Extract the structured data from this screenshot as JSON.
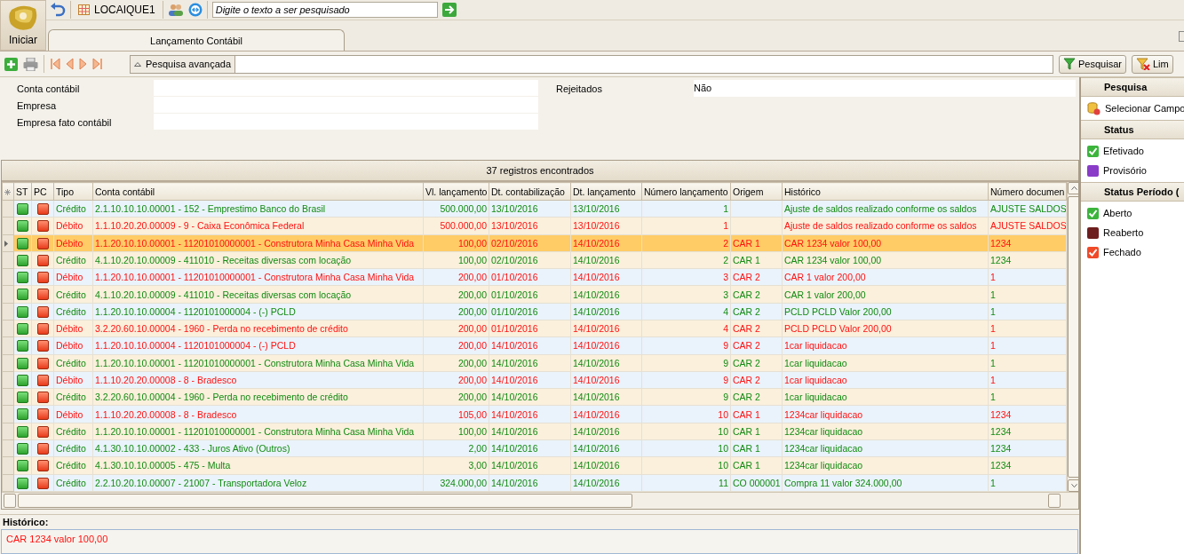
{
  "header": {
    "start_label": "Iniciar",
    "company": "LOCAIQUE1",
    "search_placeholder": "Digite o texto a ser pesquisado"
  },
  "tabs": [
    {
      "label": "Lançamento Contábil",
      "selected": true
    }
  ],
  "toolbar": {
    "advanced_search": "Pesquisa avançada",
    "search_button": "Pesquisar",
    "clear_button": "Lim"
  },
  "filters": {
    "left": [
      {
        "label": "Conta contábil"
      },
      {
        "label": "Empresa"
      },
      {
        "label": "Empresa fato contábil"
      }
    ],
    "right": [
      {
        "label": "Rejeitados",
        "value": "Não"
      }
    ]
  },
  "grid": {
    "title": "37 registros encontrados",
    "columns": [
      "ST",
      "PC",
      "Tipo",
      "Conta contábil",
      "Vl. lançamento",
      "Dt. contabilização",
      "Dt. lançamento",
      "Número lançamento",
      "Origem",
      "Histórico",
      "Número documen"
    ],
    "rows": [
      {
        "kind": "credit",
        "selected": false,
        "tipo": "Crédito",
        "conta": "2.1.10.10.10.00001 - 152 - Emprestimo Banco do Brasil",
        "valor": "500.000,00",
        "dt_cont": "13/10/2016",
        "dt_lanc": "13/10/2016",
        "numero": "1",
        "historico": "Ajuste de saldos realizado conforme os saldos",
        "documento": "AJUSTE SALDOS"
      },
      {
        "kind": "debit",
        "selected": false,
        "tipo": "Débito",
        "conta": "1.1.10.20.20.00009 - 9 - Caixa Econômica Federal",
        "valor": "500.000,00",
        "dt_cont": "13/10/2016",
        "dt_lanc": "13/10/2016",
        "numero": "1",
        "historico": "Ajuste de saldos realizado conforme os saldos",
        "documento": "AJUSTE SALDOS"
      },
      {
        "kind": "debit",
        "selected": true,
        "tipo": "Débito",
        "conta": "1.1.20.10.10.00001 - 11201010000001 - Construtora Minha Casa Minha Vida",
        "valor": "100,00",
        "dt_cont": "02/10/2016",
        "dt_lanc": "14/10/2016",
        "numero": "2",
        "origem": "CAR 1",
        "historico": "CAR 1234 valor 100,00",
        "documento": "1234"
      },
      {
        "kind": "credit",
        "selected": false,
        "tipo": "Crédito",
        "conta": "4.1.10.20.10.00009 - 411010 - Receitas diversas com locação",
        "valor": "100,00",
        "dt_cont": "02/10/2016",
        "dt_lanc": "14/10/2016",
        "numero": "2",
        "origem": "CAR 1",
        "historico": "CAR 1234 valor 100,00",
        "documento": "1234"
      },
      {
        "kind": "debit",
        "selected": false,
        "tipo": "Débito",
        "conta": "1.1.20.10.10.00001 - 11201010000001 - Construtora Minha Casa Minha Vida",
        "valor": "200,00",
        "dt_cont": "01/10/2016",
        "dt_lanc": "14/10/2016",
        "numero": "3",
        "origem": "CAR 2",
        "historico": "CAR 1 valor 200,00",
        "documento": "1"
      },
      {
        "kind": "credit",
        "selected": false,
        "tipo": "Crédito",
        "conta": "4.1.10.20.10.00009 - 411010 - Receitas diversas com locação",
        "valor": "200,00",
        "dt_cont": "01/10/2016",
        "dt_lanc": "14/10/2016",
        "numero": "3",
        "origem": "CAR 2",
        "historico": "CAR 1 valor 200,00",
        "documento": "1"
      },
      {
        "kind": "credit",
        "selected": false,
        "tipo": "Crédito",
        "conta": "1.1.20.10.10.00004 - 1120101000004 - (-) PCLD",
        "valor": "200,00",
        "dt_cont": "01/10/2016",
        "dt_lanc": "14/10/2016",
        "numero": "4",
        "origem": "CAR 2",
        "historico": "PCLD PCLD Valor 200,00",
        "documento": "1"
      },
      {
        "kind": "debit",
        "selected": false,
        "tipo": "Débito",
        "conta": "3.2.20.60.10.00004 - 1960 - Perda no recebimento de crédito",
        "valor": "200,00",
        "dt_cont": "01/10/2016",
        "dt_lanc": "14/10/2016",
        "numero": "4",
        "origem": "CAR 2",
        "historico": "PCLD PCLD Valor 200,00",
        "documento": "1"
      },
      {
        "kind": "debit",
        "selected": false,
        "tipo": "Débito",
        "conta": "1.1.20.10.10.00004 - 1120101000004 - (-) PCLD",
        "valor": "200,00",
        "dt_cont": "14/10/2016",
        "dt_lanc": "14/10/2016",
        "numero": "9",
        "origem": "CAR 2",
        "historico": "1car liquidacao",
        "documento": "1"
      },
      {
        "kind": "credit",
        "selected": false,
        "tipo": "Crédito",
        "conta": "1.1.20.10.10.00001 - 11201010000001 - Construtora Minha Casa Minha Vida",
        "valor": "200,00",
        "dt_cont": "14/10/2016",
        "dt_lanc": "14/10/2016",
        "numero": "9",
        "origem": "CAR 2",
        "historico": "1car liquidacao",
        "documento": "1"
      },
      {
        "kind": "debit",
        "selected": false,
        "tipo": "Débito",
        "conta": "1.1.10.20.20.00008 - 8 - Bradesco",
        "valor": "200,00",
        "dt_cont": "14/10/2016",
        "dt_lanc": "14/10/2016",
        "numero": "9",
        "origem": "CAR 2",
        "historico": "1car liquidacao",
        "documento": "1"
      },
      {
        "kind": "credit",
        "selected": false,
        "tipo": "Crédito",
        "conta": "3.2.20.60.10.00004 - 1960 - Perda no recebimento de crédito",
        "valor": "200,00",
        "dt_cont": "14/10/2016",
        "dt_lanc": "14/10/2016",
        "numero": "9",
        "origem": "CAR 2",
        "historico": "1car liquidacao",
        "documento": "1"
      },
      {
        "kind": "debit",
        "selected": false,
        "tipo": "Débito",
        "conta": "1.1.10.20.20.00008 - 8 - Bradesco",
        "valor": "105,00",
        "dt_cont": "14/10/2016",
        "dt_lanc": "14/10/2016",
        "numero": "10",
        "origem": "CAR 1",
        "historico": "1234car liquidacao",
        "documento": "1234"
      },
      {
        "kind": "credit",
        "selected": false,
        "tipo": "Crédito",
        "conta": "1.1.20.10.10.00001 - 11201010000001 - Construtora Minha Casa Minha Vida",
        "valor": "100,00",
        "dt_cont": "14/10/2016",
        "dt_lanc": "14/10/2016",
        "numero": "10",
        "origem": "CAR 1",
        "historico": "1234car liquidacao",
        "documento": "1234"
      },
      {
        "kind": "credit",
        "selected": false,
        "tipo": "Crédito",
        "conta": "4.1.30.10.10.00002 - 433 - Juros Ativo (Outros)",
        "valor": "2,00",
        "dt_cont": "14/10/2016",
        "dt_lanc": "14/10/2016",
        "numero": "10",
        "origem": "CAR 1",
        "historico": "1234car liquidacao",
        "documento": "1234"
      },
      {
        "kind": "credit",
        "selected": false,
        "tipo": "Crédito",
        "conta": "4.1.30.10.10.00005 - 475 - Multa",
        "valor": "3,00",
        "dt_cont": "14/10/2016",
        "dt_lanc": "14/10/2016",
        "numero": "10",
        "origem": "CAR 1",
        "historico": "1234car liquidacao",
        "documento": "1234"
      },
      {
        "kind": "credit",
        "selected": false,
        "tipo": "Crédito",
        "conta": "2.2.10.20.10.00007 - 21007 - Transportadora Veloz",
        "valor": "324.000,00",
        "dt_cont": "14/10/2016",
        "dt_lanc": "14/10/2016",
        "numero": "11",
        "origem": "CO 000001",
        "historico": "Compra 11 valor 324.000,00",
        "documento": "1"
      }
    ]
  },
  "detail": {
    "label": "Histórico:",
    "kind": "debit",
    "text": "CAR 1234 valor 100,00"
  },
  "side_panel": [
    {
      "title": "Pesquisa",
      "items": [
        {
          "kind": "field",
          "label": "Selecionar Campo"
        }
      ]
    },
    {
      "title": "Status",
      "items": [
        {
          "kind": "check",
          "label": "Efetivado",
          "color": "#3cb43c"
        },
        {
          "kind": "square",
          "label": "Provisório",
          "color": "#8a3cc8"
        }
      ]
    },
    {
      "title": "Status Período (",
      "items": [
        {
          "kind": "check",
          "label": "Aberto",
          "color": "#3cb43c"
        },
        {
          "kind": "square",
          "label": "Reaberto",
          "color": "#6e1e1e"
        },
        {
          "kind": "check",
          "label": "Fechado",
          "color": "#f04a28"
        }
      ]
    }
  ]
}
